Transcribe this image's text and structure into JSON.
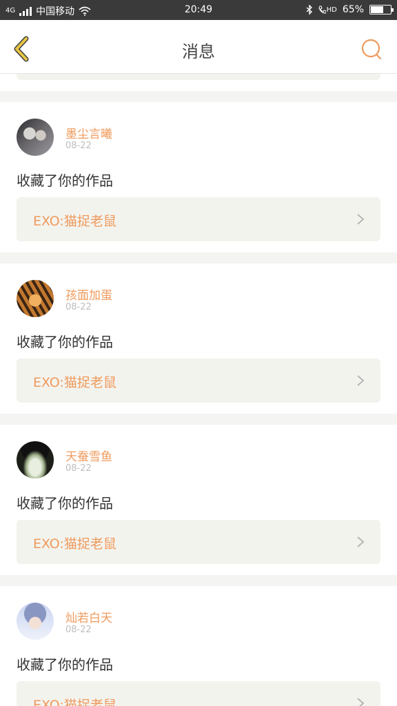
{
  "status": {
    "network": "4G",
    "carrier": "中国移动",
    "time": "20:49",
    "hd": "HD",
    "battery_percent": "65%",
    "battery_level": 0.65,
    "icons": [
      "signal-icon",
      "wifi-icon",
      "bluetooth-icon",
      "hd-call-icon",
      "battery-icon"
    ]
  },
  "nav": {
    "title": "消息",
    "back_icon": "back-chevron-icon",
    "search_icon": "search-icon"
  },
  "colors": {
    "accent_orange": "#ef9a5c",
    "back_yellow": "#e8c547",
    "card_bg": "#f3f3ee",
    "page_bg": "#f4f4f2"
  },
  "messages": [
    {
      "username": "墨尘言曦",
      "date": "08-22",
      "action": "收藏了你的作品",
      "work_title": "EXO:猫捉老鼠"
    },
    {
      "username": "孩面加蛋",
      "date": "08-22",
      "action": "收藏了你的作品",
      "work_title": "EXO:猫捉老鼠"
    },
    {
      "username": "天蚕雪鱼",
      "date": "08-22",
      "action": "收藏了你的作品",
      "work_title": "EXO:猫捉老鼠"
    },
    {
      "username": "灿若白天",
      "date": "08-22",
      "action": "收藏了你的作品",
      "work_title": "EXO:猫捉老鼠"
    }
  ]
}
